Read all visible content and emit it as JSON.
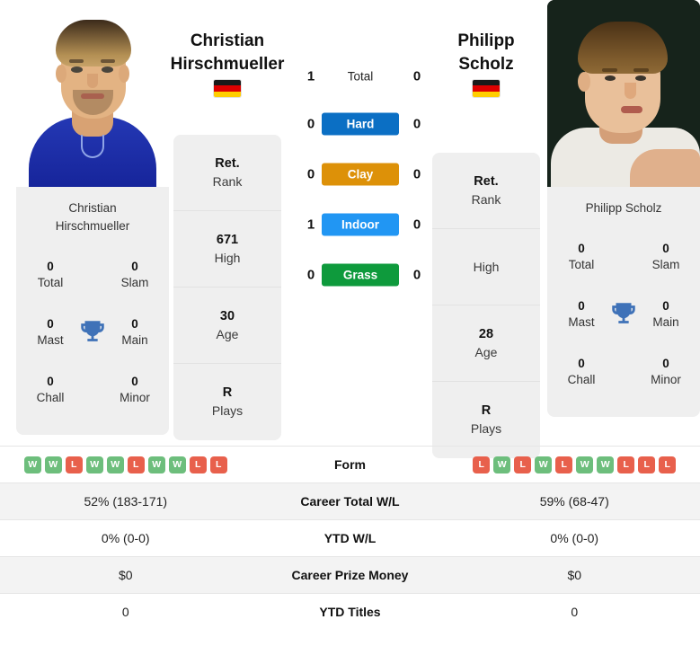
{
  "players": {
    "left": {
      "first_name": "Christian",
      "last_name": "Hirschmueller",
      "full_name_line1": "Christian",
      "full_name_line2": "Hirschmueller",
      "country": "Germany",
      "flag_icon": "germany-flag-icon",
      "photo_alt": "christian-hirschmueller-photo",
      "titles": {
        "total_value": "0",
        "total_label": "Total",
        "slam_value": "0",
        "slam_label": "Slam",
        "mast_value": "0",
        "mast_label": "Mast",
        "main_value": "0",
        "main_label": "Main",
        "chall_value": "0",
        "chall_label": "Chall",
        "minor_value": "0",
        "minor_label": "Minor"
      },
      "stats": [
        {
          "value": "Ret.",
          "label": "Rank"
        },
        {
          "value": "671",
          "label": "High"
        },
        {
          "value": "30",
          "label": "Age"
        },
        {
          "value": "R",
          "label": "Plays"
        }
      ],
      "form": [
        "W",
        "W",
        "L",
        "W",
        "W",
        "L",
        "W",
        "W",
        "L",
        "L"
      ],
      "career_wl": "52% (183-171)",
      "ytd_wl": "0% (0-0)",
      "prize_money": "$0",
      "ytd_titles": "0"
    },
    "right": {
      "first_name": "Philipp",
      "last_name": "Scholz",
      "full_name_line1": "Philipp",
      "full_name_line2": "Scholz",
      "full_name": "Philipp Scholz",
      "country": "Germany",
      "flag_icon": "germany-flag-icon",
      "photo_alt": "philipp-scholz-photo",
      "titles": {
        "total_value": "0",
        "total_label": "Total",
        "slam_value": "0",
        "slam_label": "Slam",
        "mast_value": "0",
        "mast_label": "Mast",
        "main_value": "0",
        "main_label": "Main",
        "chall_value": "0",
        "chall_label": "Chall",
        "minor_value": "0",
        "minor_label": "Minor"
      },
      "stats": [
        {
          "value": "Ret.",
          "label": "Rank"
        },
        {
          "value": "",
          "label": "High"
        },
        {
          "value": "28",
          "label": "Age"
        },
        {
          "value": "R",
          "label": "Plays"
        }
      ],
      "form": [
        "L",
        "W",
        "L",
        "W",
        "L",
        "W",
        "W",
        "L",
        "L",
        "L"
      ],
      "career_wl": "59% (68-47)",
      "ytd_wl": "0% (0-0)",
      "prize_money": "$0",
      "ytd_titles": "0"
    }
  },
  "head_to_head": [
    {
      "label": "Total",
      "left": "1",
      "right": "0",
      "color": "",
      "kind": "total"
    },
    {
      "label": "Hard",
      "left": "0",
      "right": "0",
      "color": "#0b6fc4",
      "kind": "surface"
    },
    {
      "label": "Clay",
      "left": "0",
      "right": "0",
      "color": "#dd9108",
      "kind": "surface"
    },
    {
      "label": "Indoor",
      "left": "1",
      "right": "0",
      "color": "#2196f3",
      "kind": "surface"
    },
    {
      "label": "Grass",
      "left": "0",
      "right": "0",
      "color": "#0e9a3c",
      "kind": "surface"
    }
  ],
  "table_rows": [
    {
      "label": "Form",
      "type": "form"
    },
    {
      "label": "Career Total W/L",
      "type": "text",
      "key": "career_wl"
    },
    {
      "label": "YTD W/L",
      "type": "text",
      "key": "ytd_wl"
    },
    {
      "label": "Career Prize Money",
      "type": "text",
      "key": "prize_money"
    },
    {
      "label": "YTD Titles",
      "type": "text",
      "key": "ytd_titles"
    }
  ],
  "colors": {
    "win_badge": "#6dbe7c",
    "loss_badge": "#e8604c",
    "card_bg": "#efefef",
    "row_alt_bg": "#f3f3f3",
    "trophy": "#3f72b8",
    "flag_black": "#1a1a1a",
    "flag_red": "#dd0000",
    "flag_gold": "#ffce00"
  },
  "labels": {
    "win": "W",
    "loss": "L"
  }
}
